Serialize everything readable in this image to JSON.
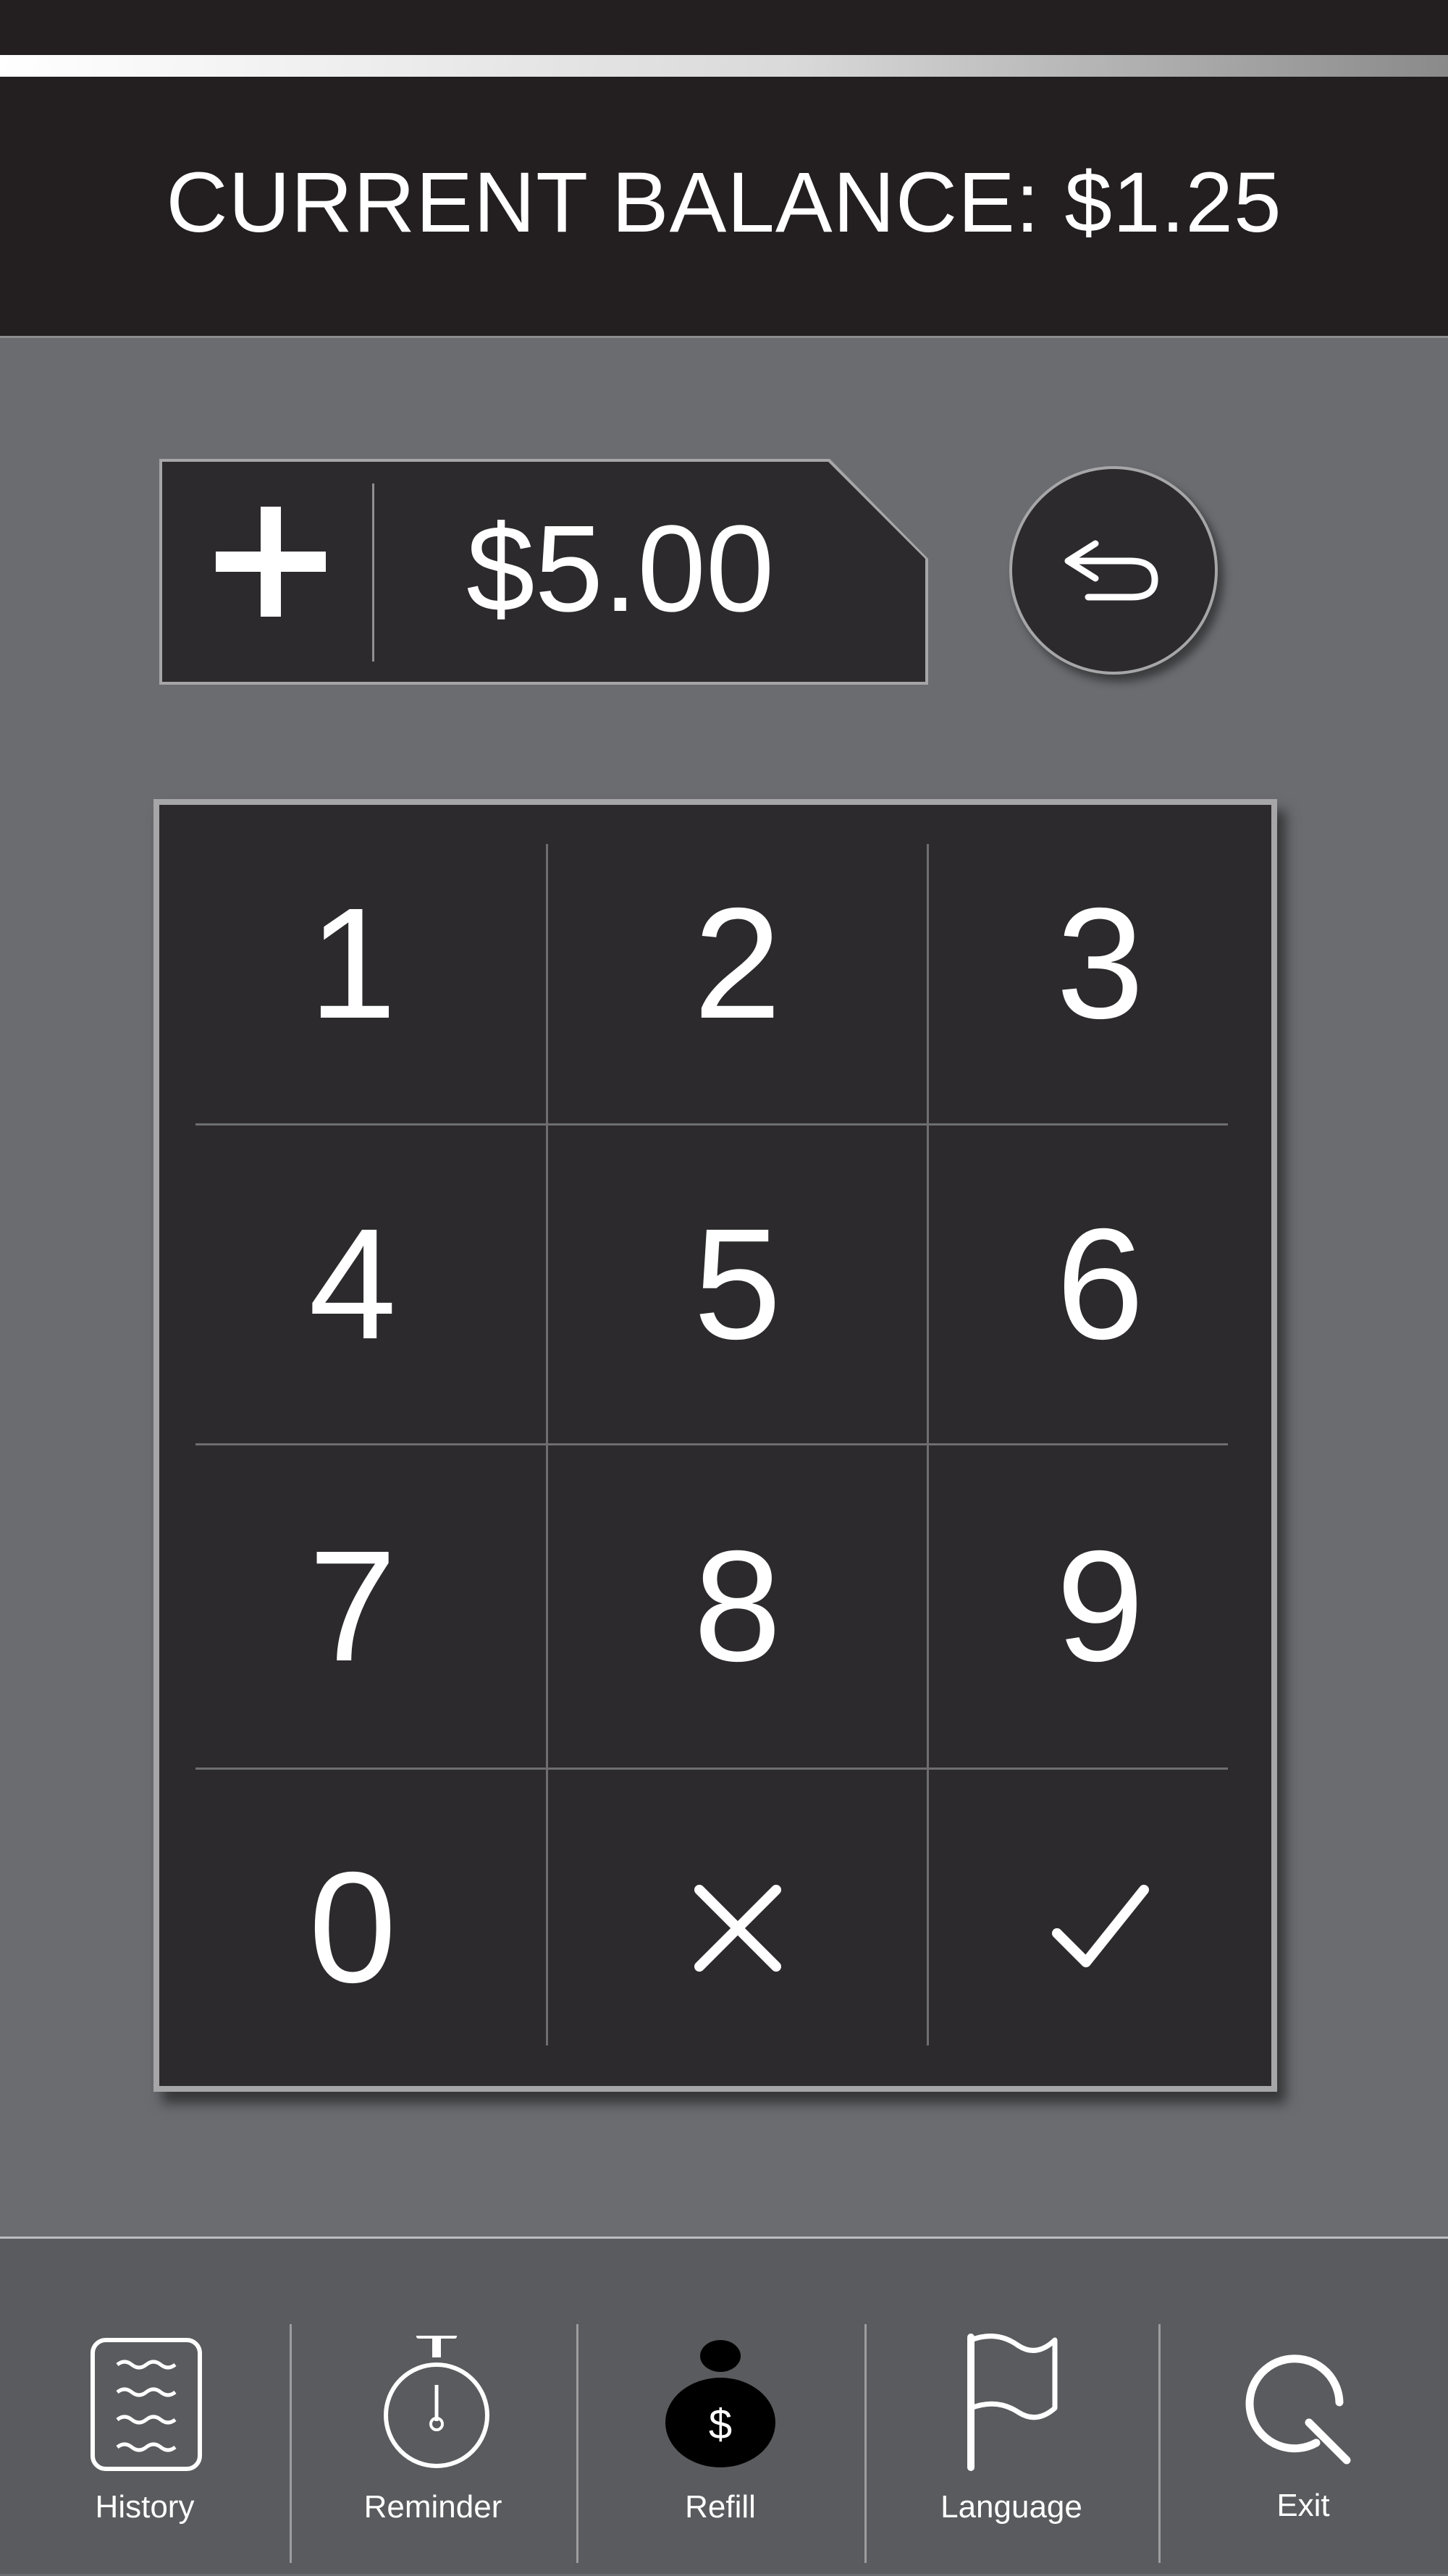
{
  "header": {
    "title": "CURRENT BALANCE: $1.25"
  },
  "amount": {
    "prefix_icon": "plus-icon",
    "value": "$5.00"
  },
  "back_button": {
    "icon": "back-arrow-icon"
  },
  "keypad": {
    "keys": [
      "1",
      "2",
      "3",
      "4",
      "5",
      "6",
      "7",
      "8",
      "9",
      "0"
    ],
    "clear_icon": "clear-x-icon",
    "confirm_icon": "checkmark-icon"
  },
  "nav": {
    "items": [
      {
        "label": "History",
        "icon": "document-icon"
      },
      {
        "label": "Reminder",
        "icon": "stopwatch-icon"
      },
      {
        "label": "Refill",
        "icon": "money-bag-icon"
      },
      {
        "label": "Language",
        "icon": "flag-icon"
      },
      {
        "label": "Exit",
        "icon": "exit-icon"
      }
    ]
  },
  "colors": {
    "background": "#6b6c70",
    "dark_panel": "#2c2a2c",
    "header": "#231f20",
    "nav": "#5a5b5e",
    "text": "#ffffff"
  }
}
